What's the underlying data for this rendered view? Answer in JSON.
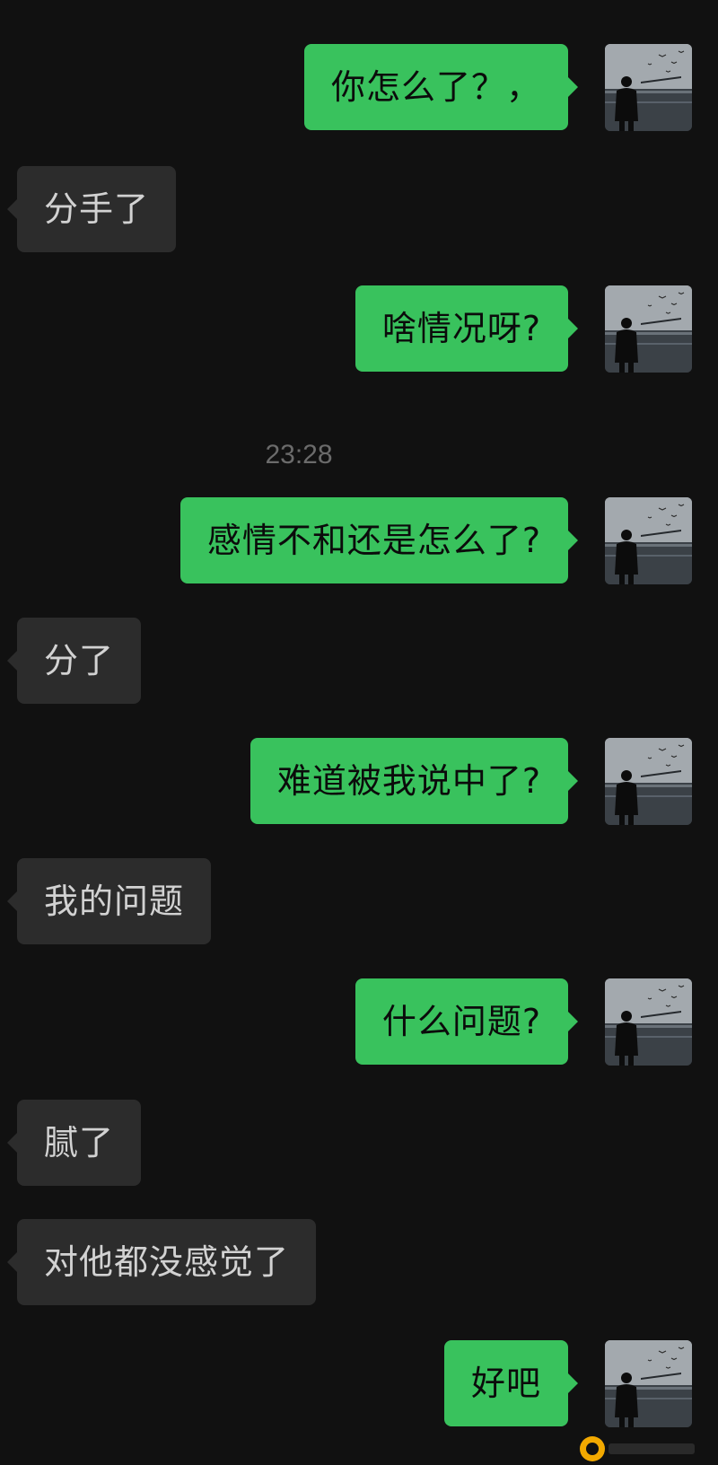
{
  "chat": {
    "timestamp": "23:28",
    "messages": [
      {
        "side": "out",
        "text": "你怎么了？，"
      },
      {
        "side": "in",
        "text": "分手了"
      },
      {
        "side": "out",
        "text": "啥情况呀?"
      },
      {
        "side": "out",
        "text": "感情不和还是怎么了?"
      },
      {
        "side": "in",
        "text": "分了"
      },
      {
        "side": "out",
        "text": "难道被我说中了?"
      },
      {
        "side": "in",
        "text": "我的问题"
      },
      {
        "side": "out",
        "text": "什么问题?"
      },
      {
        "side": "in",
        "text": "腻了"
      },
      {
        "side": "in",
        "text": "对他都没感觉了"
      },
      {
        "side": "out",
        "text": "好吧"
      }
    ]
  },
  "colors": {
    "background": "#111111",
    "outgoing_bubble": "#39c25d",
    "incoming_bubble": "#2c2c2c",
    "incoming_text": "#d2d2d2",
    "timestamp_text": "#6b6b6b"
  },
  "icons": {
    "avatar": "person-standing-by-sea-avatar",
    "watermark": "site-logo-watermark"
  }
}
